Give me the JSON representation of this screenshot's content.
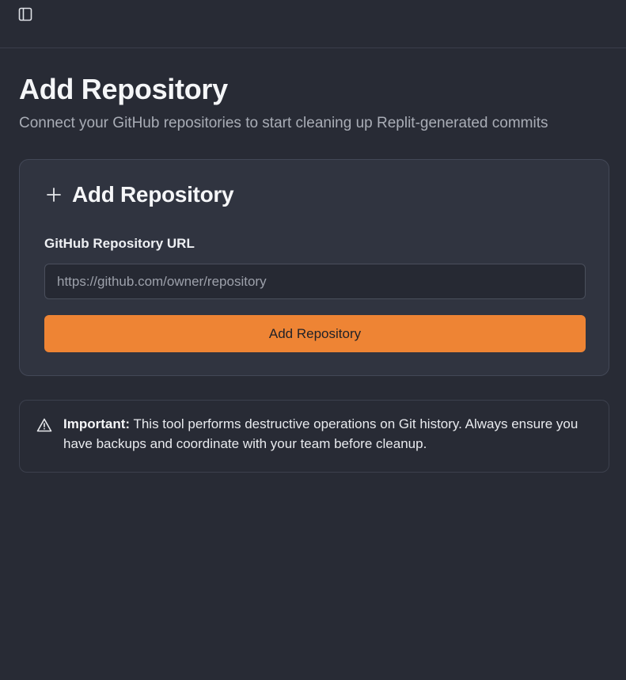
{
  "topbar": {
    "toggle_icon": "sidebar-panel-icon"
  },
  "header": {
    "title": "Add Repository",
    "subtitle": "Connect your GitHub repositories to start cleaning up Replit-generated commits"
  },
  "card": {
    "icon": "plus-icon",
    "title": "Add Repository",
    "field_label": "GitHub Repository URL",
    "input_value": "",
    "input_placeholder": "https://github.com/owner/repository",
    "button_label": "Add Repository",
    "button_color": "#ee8434"
  },
  "alert": {
    "icon": "warning-triangle-icon",
    "label": "Important:",
    "message": " This tool performs destructive operations on Git history. Always ensure you have backups and coordinate with your team before cleanup."
  },
  "colors": {
    "background": "#282b35",
    "card_background": "#303440",
    "accent": "#ee8434"
  }
}
